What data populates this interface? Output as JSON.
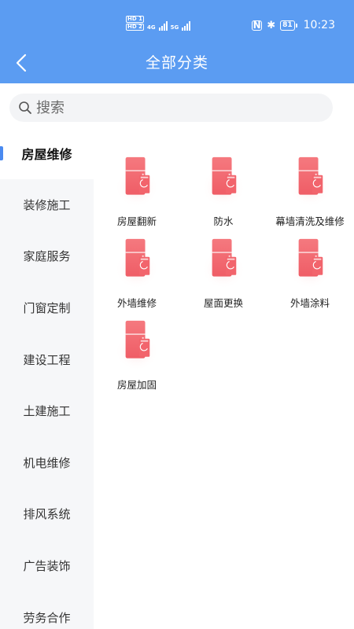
{
  "status_bar": {
    "sim1": "HD 1",
    "sim2": "HD 2",
    "net1": "4G",
    "net2": "5G",
    "battery": "81",
    "time": "10:23"
  },
  "header": {
    "title": "全部分类"
  },
  "search": {
    "placeholder": "搜索"
  },
  "sidebar": {
    "items": [
      {
        "label": "房屋维修",
        "active": true
      },
      {
        "label": "装修施工"
      },
      {
        "label": "家庭服务"
      },
      {
        "label": "门窗定制"
      },
      {
        "label": "建设工程"
      },
      {
        "label": "土建施工"
      },
      {
        "label": "机电维修"
      },
      {
        "label": "排风系统"
      },
      {
        "label": "广告装饰"
      },
      {
        "label": "劳务合作"
      }
    ]
  },
  "grid": {
    "items": [
      {
        "label": "房屋翻新",
        "icon": "appliance-icon"
      },
      {
        "label": "防水",
        "icon": "appliance-icon"
      },
      {
        "label": "幕墙清洗及维修",
        "icon": "appliance-icon"
      },
      {
        "label": "外墙维修",
        "icon": "appliance-icon"
      },
      {
        "label": "屋面更换",
        "icon": "appliance-icon"
      },
      {
        "label": "外墙涂料",
        "icon": "appliance-icon"
      },
      {
        "label": "房屋加固",
        "icon": "appliance-icon"
      }
    ]
  },
  "colors": {
    "header_bg": "#5b9cf2",
    "accent": "#4a8af0",
    "icon_red": "#f05a62"
  }
}
